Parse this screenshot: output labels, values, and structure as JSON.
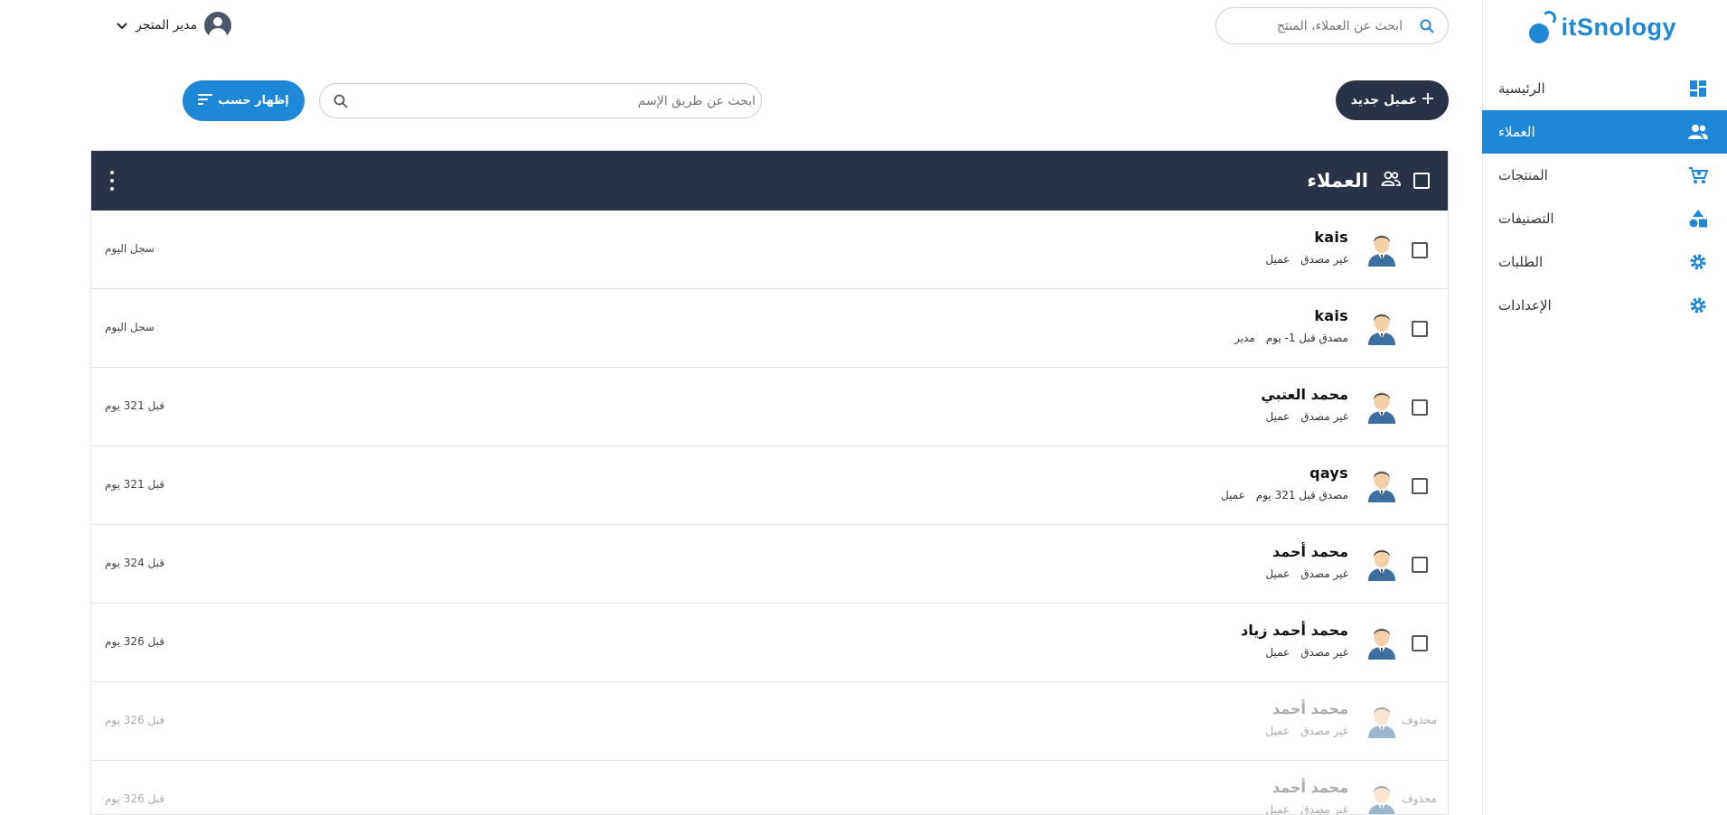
{
  "header": {
    "logo_text": "itSnology",
    "search_placeholder": "ابحث عن العملاء، المنتج",
    "user_name": "مدير المتجر"
  },
  "sidebar": {
    "items": [
      {
        "label": "الرئيسية",
        "icon": "dashboard-icon",
        "active": false
      },
      {
        "label": "العملاء",
        "icon": "users-icon",
        "active": true
      },
      {
        "label": "المنتجات",
        "icon": "cart-icon",
        "active": false
      },
      {
        "label": "التصنيفات",
        "icon": "shapes-icon",
        "active": false
      },
      {
        "label": "الطلبات",
        "icon": "gear-icon",
        "active": false
      },
      {
        "label": "الإعدادات",
        "icon": "gear-icon",
        "active": false
      }
    ]
  },
  "toolbar": {
    "new_customer_label": "عميل جديد",
    "name_search_placeholder": "ابحث عن طريق الإسم",
    "show_by_label": "إظهار حسب"
  },
  "panel": {
    "title": "العملاء"
  },
  "customers": [
    {
      "name": "kais",
      "status": "غير مصدق",
      "role": "عميل",
      "time": "سجل اليوم",
      "deleted": false
    },
    {
      "name": "kais",
      "status": "مصدق قبل 1- يوم",
      "role": "مدير",
      "time": "سجل اليوم",
      "deleted": false
    },
    {
      "name": "محمد العتبي",
      "status": "غير مصدق",
      "role": "عميل",
      "time": "قبل 321 يوم",
      "deleted": false
    },
    {
      "name": "qays",
      "status": "مصدق قبل 321 يوم",
      "role": "عميل",
      "time": "قبل 321 يوم",
      "deleted": false
    },
    {
      "name": "محمد أحمد",
      "status": "غير مصدق",
      "role": "عميل",
      "time": "قبل 324 يوم",
      "deleted": false
    },
    {
      "name": "محمد أحمد زياد",
      "status": "غير مصدق",
      "role": "عميل",
      "time": "قبل 326 يوم",
      "deleted": false
    },
    {
      "name": "محمد أحمد",
      "status": "غير مصدق",
      "role": "عميل",
      "time": "قبل 326 يوم",
      "deleted": true,
      "deleted_label": "محذوف"
    },
    {
      "name": "محمد أحمد",
      "status": "غير مصدق",
      "role": "عميل",
      "time": "قبل 326 يوم",
      "deleted": true,
      "deleted_label": "محذوف"
    }
  ],
  "colors": {
    "accent": "#1e88d6",
    "dark": "#2a3345"
  }
}
